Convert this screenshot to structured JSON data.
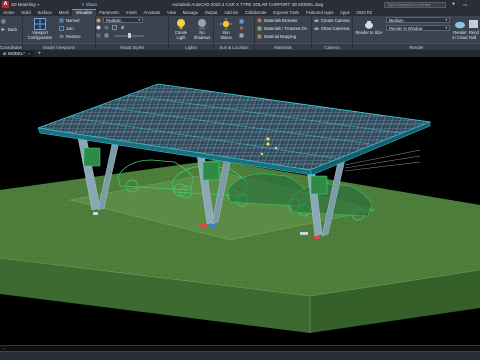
{
  "titlebar": {
    "workspace": "3D Modeling",
    "share": "Share",
    "title": "Autodesk AutoCAD 2023   4 CAR X TYPE SOLAR CARPORT 3D MODEL.dwg",
    "search_placeholder": "Type a keyword or phrase"
  },
  "tabs": [
    "Home",
    "Solid",
    "Surface",
    "Mesh",
    "Visualize",
    "Parametric",
    "Insert",
    "Annotate",
    "View",
    "Manage",
    "Output",
    "Add-ins",
    "Collaborate",
    "Express Tools",
    "Featured Apps",
    "Apps",
    "2023 R2"
  ],
  "ribbon": {
    "panels": {
      "coordinates": "Coordinates",
      "model_viewports": "Model Viewports",
      "visual_styles": "Visual Styles",
      "lights": "Lights",
      "sun_location": "Sun & Location",
      "materials": "Materials",
      "camera": "Camera",
      "render": "Render"
    },
    "back_label": "Back",
    "named_label": "Named",
    "join_label": "Join",
    "restore_label": "Restore",
    "viewport_config_label": "Viewport Configuration",
    "visual_style_value": "Realistic",
    "create_light_label": "Create Light",
    "no_shadows_label": "No Shadows",
    "sun_status_label": "Sun Status",
    "materials_browser": "Materials Browser",
    "materials_textures": "Materials / Textures On",
    "material_mapping": "Material Mapping",
    "create_camera": "Create Camera",
    "show_cameras": "Show Cameras",
    "render_to_size": "Render to Size",
    "render_quality": "Medium",
    "render_in": "Render in Window",
    "render_in_cloud": "Render in Cloud",
    "gallery_label": "Rend Gall"
  },
  "viewport": {
    "tab_label": "ar MODEL*",
    "close_glyph": "×",
    "add_glyph": "+",
    "label": ""
  },
  "colors": {
    "accent": "#4fa3e0",
    "grass_top": "#4b7d3a",
    "grass_side": "#3e6a30",
    "wireframe": "#3fd06a",
    "panel_frame": "#37d3e0"
  }
}
